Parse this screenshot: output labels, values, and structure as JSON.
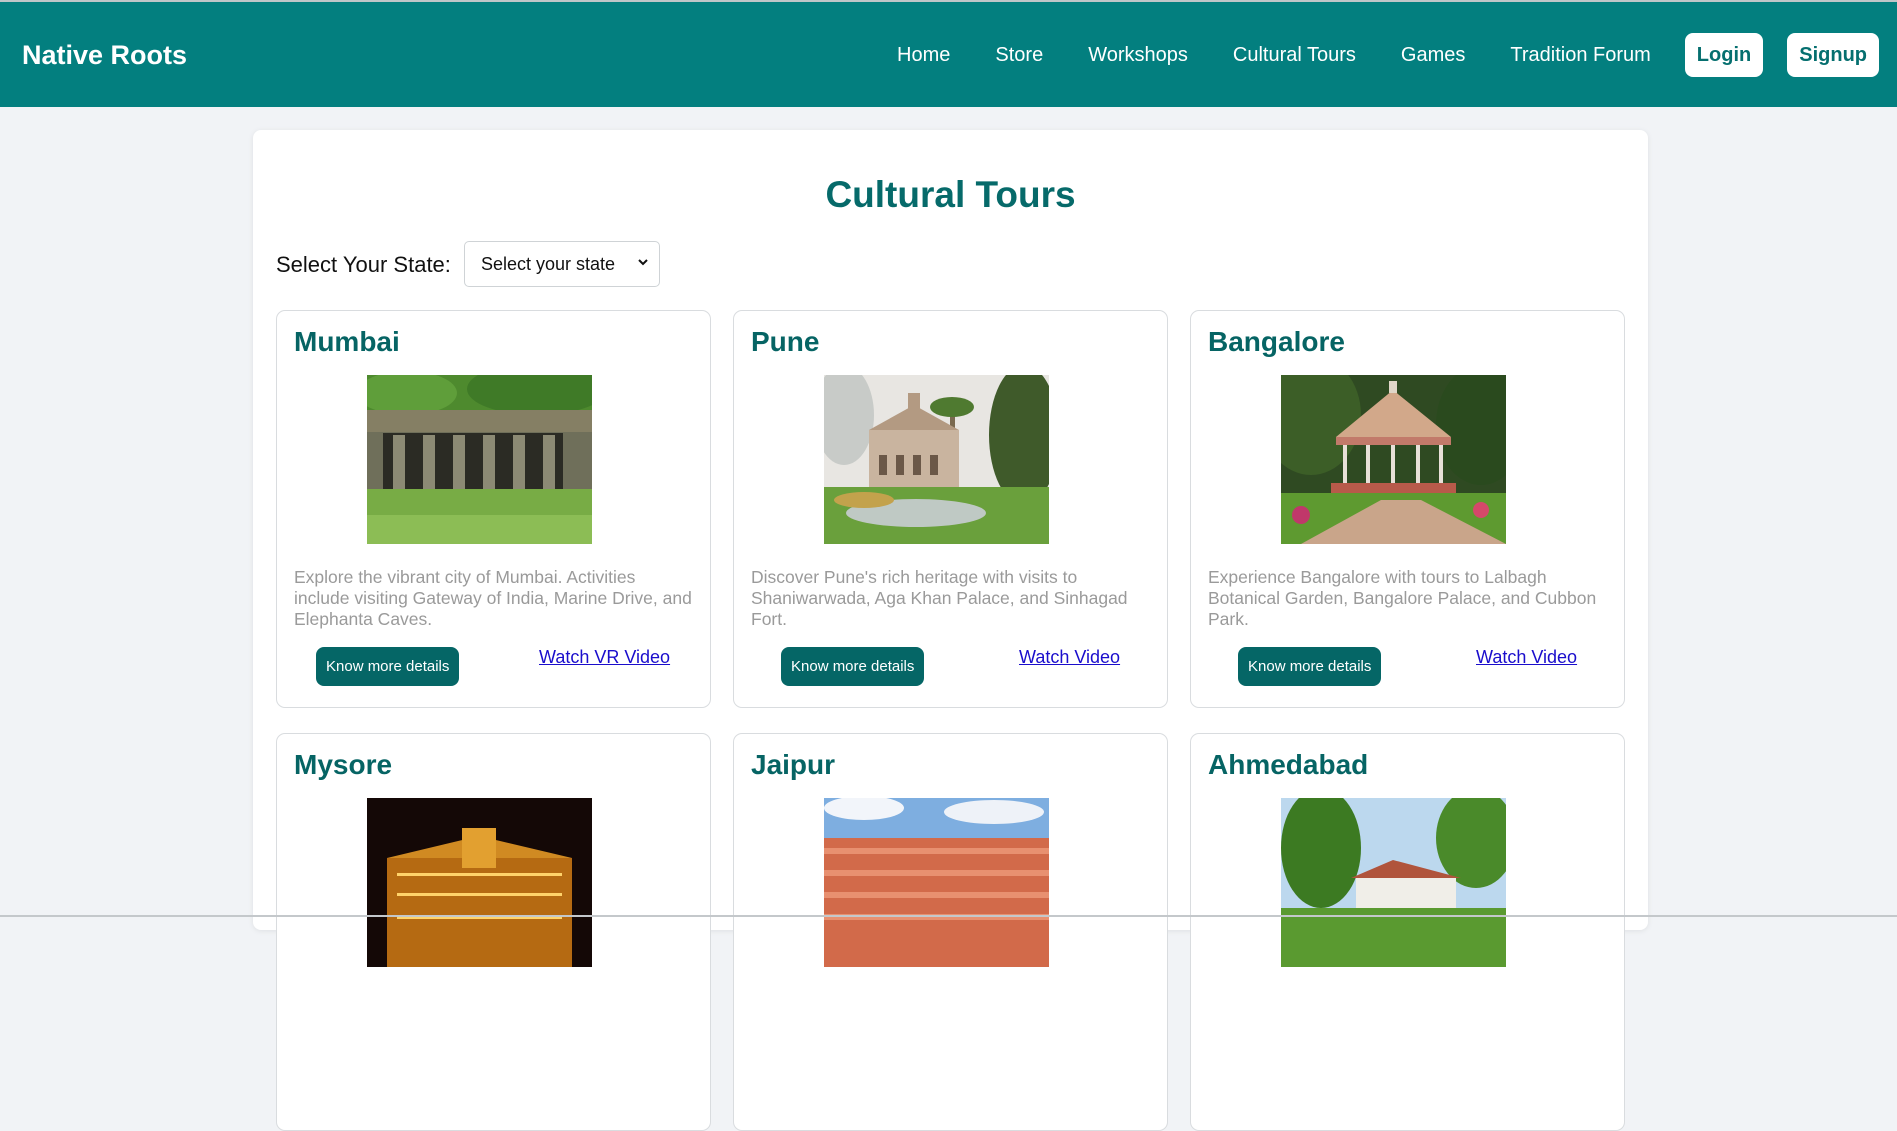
{
  "brand": "Native Roots",
  "nav": {
    "links": [
      "Home",
      "Store",
      "Workshops",
      "Cultural Tours",
      "Games",
      "Tradition Forum"
    ],
    "login": "Login",
    "signup": "Signup"
  },
  "page": {
    "title": "Cultural Tours",
    "state_label": "Select Your State:",
    "state_select_value": "Select your state"
  },
  "cards": [
    {
      "title": "Mumbai",
      "image": "elephanta-caves-photo",
      "description": "Explore the vibrant city of Mumbai. Activities include visiting Gateway of India, Marine Drive, and Elephanta Caves.",
      "details_label": "Know more details",
      "link_label": "Watch VR Video"
    },
    {
      "title": "Pune",
      "image": "aga-khan-palace-photo",
      "description": "Discover Pune's rich heritage with visits to Shaniwarwada, Aga Khan Palace, and Sinhagad Fort.",
      "details_label": "Know more details",
      "link_label": "Watch Video"
    },
    {
      "title": "Bangalore",
      "image": "lalbagh-bandstand-photo",
      "description": "Experience Bangalore with tours to Lalbagh Botanical Garden, Bangalore Palace, and Cubbon Park.",
      "details_label": "Know more details",
      "link_label": "Watch Video"
    },
    {
      "title": "Mysore",
      "image": "mysore-palace-night-photo"
    },
    {
      "title": "Jaipur",
      "image": "hawa-mahal-photo"
    },
    {
      "title": "Ahmedabad",
      "image": "sabarmati-ashram-photo"
    }
  ],
  "colors": {
    "header_bg": "#037f7f",
    "accent_text": "#066a6a",
    "button_bg": "#056666",
    "link": "#1a0dcc",
    "page_bg": "#f1f3f6"
  }
}
